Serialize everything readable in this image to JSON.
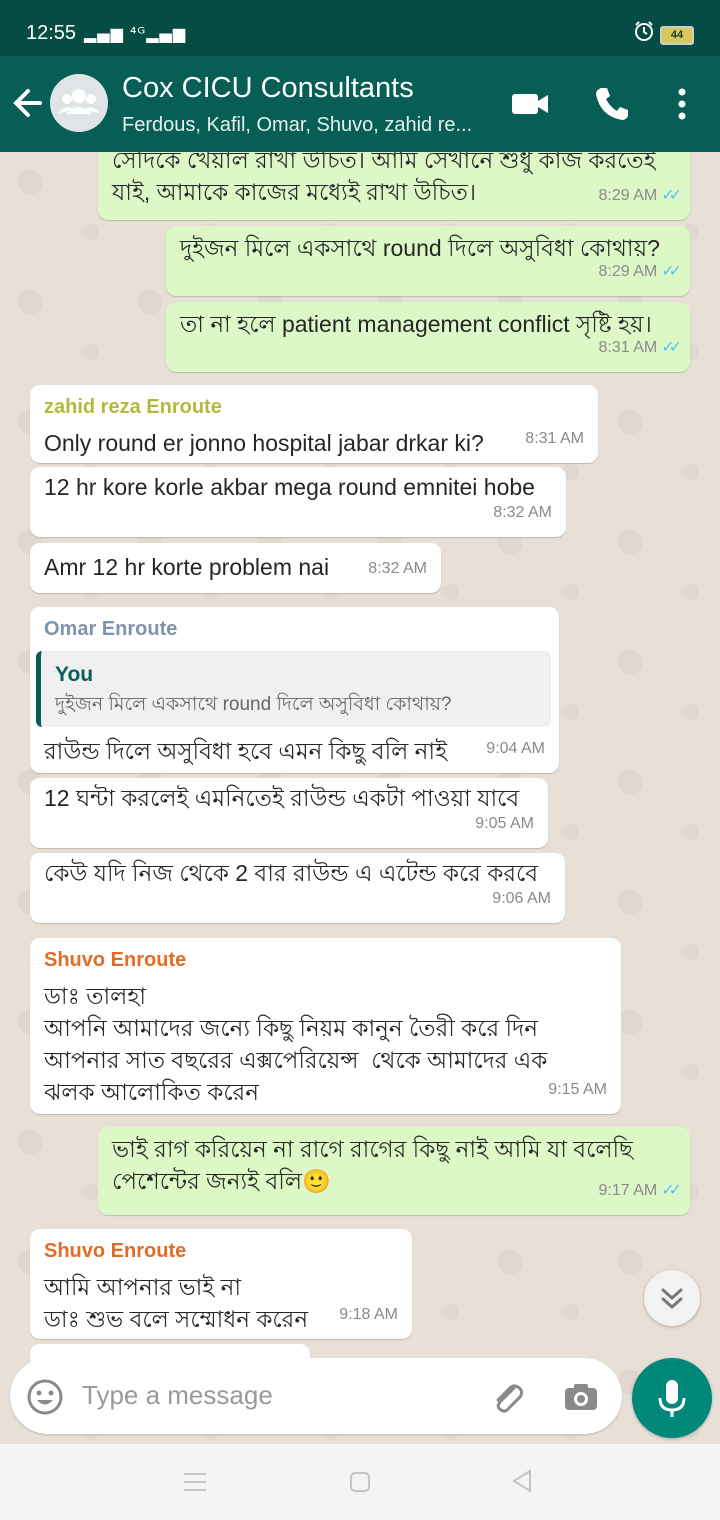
{
  "status_bar": {
    "time": "12:55",
    "signal": "▂▄▆ ⁴ᴳ▂▄▆",
    "battery": "44"
  },
  "header": {
    "title": "Cox CICU Consultants",
    "subtitle": "Ferdous, Kafil, Omar, Shuvo, zahid re..."
  },
  "messages": [
    {
      "dir": "out",
      "text": "সেদিকে খেয়াল রাখা উচিত। আমি সেখানে শুধু কাজ করতেই\nযাই, আমাকে কাজের মধ্যেই রাখা উচিত।",
      "time": "8:29 AM",
      "ticks": "✓✓"
    },
    {
      "dir": "out",
      "text": "দুইজন মিলে একসাথে round দিলে অসুবিধা কোথায়?",
      "time": "8:29 AM",
      "ticks": "✓✓"
    },
    {
      "dir": "out",
      "text": "তা না হলে patient management conflict সৃষ্টি হয়।",
      "time": "8:31 AM",
      "ticks": "✓✓"
    },
    {
      "dir": "in",
      "sender": "zahid reza Enroute",
      "text": "Only round er jonno hospital jabar drkar ki?",
      "time": "8:31 AM"
    },
    {
      "dir": "in",
      "text": "12 hr kore korle akbar mega round emnitei hobe",
      "time": "8:32 AM"
    },
    {
      "dir": "in",
      "text": "Amr 12 hr korte problem nai",
      "time": "8:32 AM"
    },
    {
      "dir": "in",
      "sender": "Omar Enroute",
      "quote_name": "You",
      "quote_text": "দুইজন মিলে একসাথে round দিলে অসুবিধা কোথায়?",
      "text": "রাউন্ড দিলে অসুবিধা হবে এমন কিছু বলি নাই",
      "time": "9:04 AM"
    },
    {
      "dir": "in",
      "text": "12 ঘন্টা করলেই এমনিতেই রাউন্ড একটা পাওয়া যাবে",
      "time": "9:05 AM"
    },
    {
      "dir": "in",
      "text": "কেউ যদি নিজ থেকে 2 বার রাউন্ড এ এটেন্ড করে করবে",
      "time": "9:06 AM"
    },
    {
      "dir": "in",
      "sender": "Shuvo Enroute",
      "text": "ডাঃ তালহা\nআপনি আমাদের জন্যে কিছু নিয়ম কানুন তৈরী করে দিন\nআপনার সাত বছরের এক্সপেরিয়েন্স  থেকে আমাদের এক\nঝলক আলোকিত করেন",
      "time": "9:15 AM"
    },
    {
      "dir": "out",
      "text": "ভাই রাগ করিয়েন না রাগে রাগের কিছু নাই আমি যা বলেছি\nপেশেন্টের জন্যই বলি🙂",
      "time": "9:17 AM",
      "ticks": "✓✓"
    },
    {
      "dir": "in",
      "sender": "Shuvo Enroute",
      "text": "আমি আপনার ভাই না\nডাঃ শুভ বলে সম্মোধন করেন",
      "time": "9:18 AM"
    }
  ],
  "input": {
    "placeholder": "Type a message"
  },
  "colors": {
    "header": "#075e54",
    "status_bar": "#054d44",
    "outgoing": "#dcf8c6",
    "incoming": "#ffffff",
    "mic": "#00897b",
    "sender_zahid": "#b5b93a",
    "sender_omar": "#7f93ad",
    "sender_shuvo": "#e26b26",
    "read_ticks": "#4fc3f7"
  },
  "icons": [
    "back-arrow-icon",
    "group-avatar-icon",
    "video-call-icon",
    "voice-call-icon",
    "more-options-icon",
    "emoji-icon",
    "attach-icon",
    "camera-icon",
    "mic-icon",
    "scroll-down-icon",
    "nav-menu-icon",
    "nav-home-icon",
    "nav-back-icon"
  ]
}
